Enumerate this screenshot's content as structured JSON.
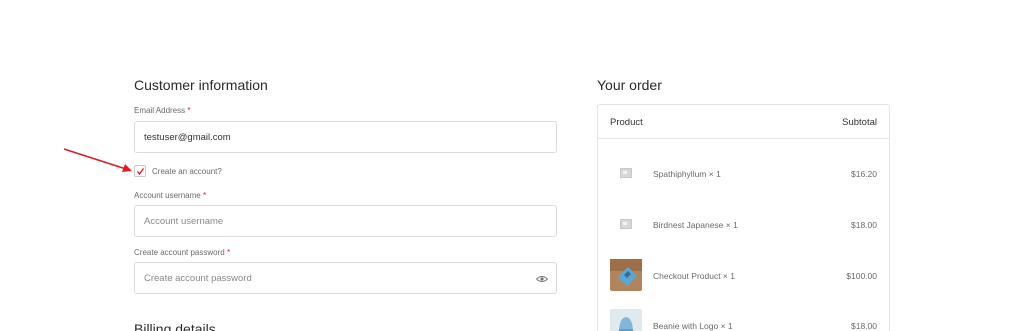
{
  "customer": {
    "title": "Customer information",
    "email_label": "Email Address",
    "email_value": "testuser@gmail.com",
    "create_account_label": "Create an account?",
    "create_account_checked": true,
    "username_label": "Account username",
    "username_placeholder": "Account username",
    "password_label": "Create account password",
    "password_placeholder": "Create account password",
    "required_marker": "*"
  },
  "billing": {
    "title": "Billing details"
  },
  "order": {
    "title": "Your order",
    "col_product": "Product",
    "col_subtotal": "Subtotal",
    "items": [
      {
        "name": "Spathiphyllum × 1",
        "price": "$16.20",
        "thumb": "placeholder-image-icon"
      },
      {
        "name": "Birdnest Japanese × 1",
        "price": "$18.00",
        "thumb": "placeholder-image-icon"
      },
      {
        "name": "Checkout Product × 1",
        "price": "$100.00",
        "thumb": "product-photo-blue-box"
      },
      {
        "name": "Beanie with Logo × 1",
        "price": "$18.00",
        "thumb": "product-photo-beanie"
      }
    ]
  },
  "colors": {
    "required": "#e01b24",
    "arrow": "#e01b24",
    "checkmark": "#e01b24"
  }
}
